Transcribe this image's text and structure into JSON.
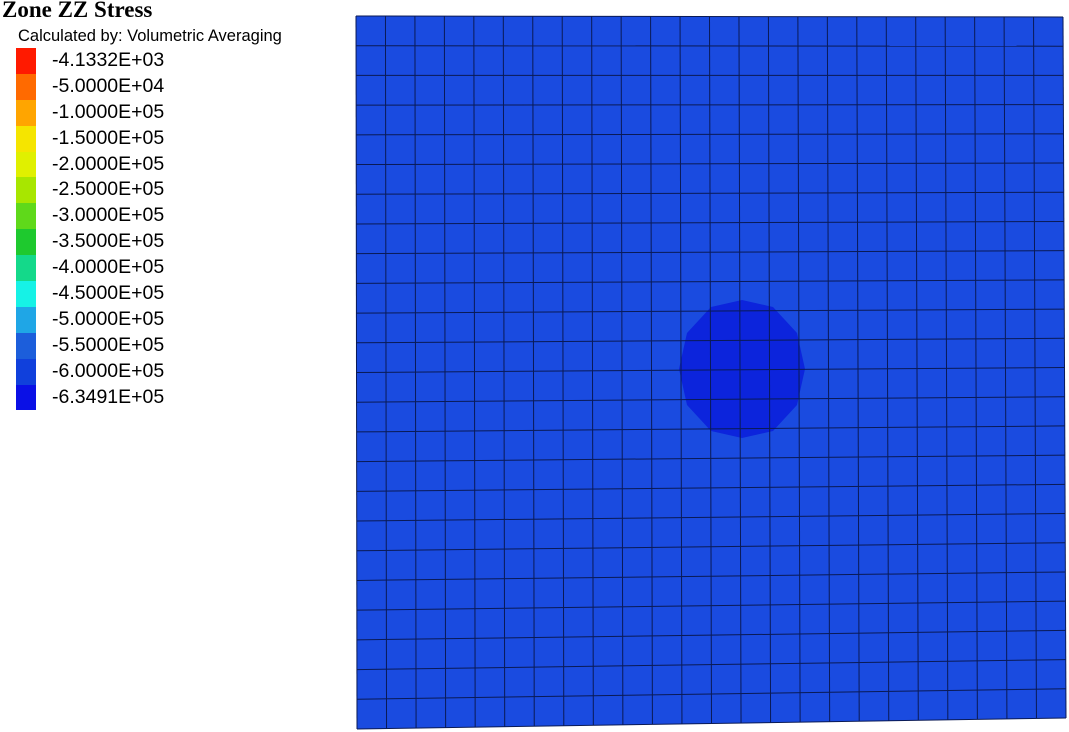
{
  "title": "Zone ZZ Stress",
  "subtitle": "Calculated by: Volumetric Averaging",
  "legend": [
    {
      "label": "-4.1332E+03",
      "color": "#ff1a00"
    },
    {
      "label": "-5.0000E+04",
      "color": "#ff6a00"
    },
    {
      "label": "-1.0000E+05",
      "color": "#ffa500"
    },
    {
      "label": "-1.5000E+05",
      "color": "#f5e500"
    },
    {
      "label": "-2.0000E+05",
      "color": "#e0f000"
    },
    {
      "label": "-2.5000E+05",
      "color": "#a8e600"
    },
    {
      "label": "-3.0000E+05",
      "color": "#5fd91a"
    },
    {
      "label": "-3.5000E+05",
      "color": "#1ec92e"
    },
    {
      "label": "-4.0000E+05",
      "color": "#14d98a"
    },
    {
      "label": "-4.5000E+05",
      "color": "#16f2e6"
    },
    {
      "label": "-5.0000E+05",
      "color": "#1fa6e6"
    },
    {
      "label": "-5.5000E+05",
      "color": "#1c5edb"
    },
    {
      "label": "-6.0000E+05",
      "color": "#1040dc"
    },
    {
      "label": "-6.3491E+05",
      "color": "#0a10e6"
    }
  ],
  "model": {
    "mesh_columns": 24,
    "mesh_rows": 24,
    "field_color": "#1a4be0",
    "inclusion_color": "#0c24dc",
    "grid_line_color": "#0a1a55"
  }
}
